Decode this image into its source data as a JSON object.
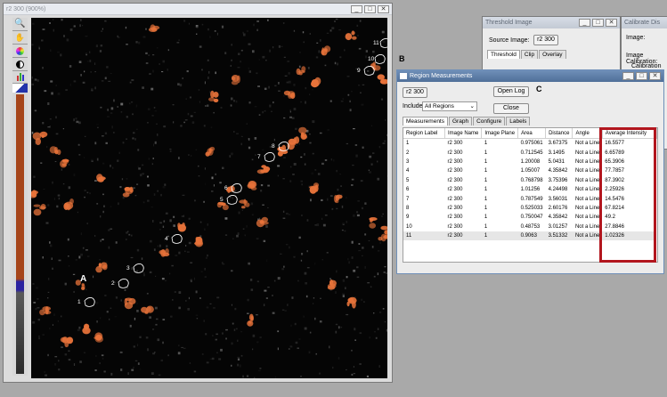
{
  "image_window": {
    "title": "r2 300 (900%)",
    "controls": [
      "_",
      "□",
      "✕"
    ],
    "tools": [
      "zoom-icon",
      "pan-icon",
      "color-wheel-icon",
      "contrast-icon",
      "histogram-icon",
      "arrow-icon"
    ],
    "region_labels": [
      "1",
      "2",
      "3",
      "4",
      "5",
      "6",
      "7",
      "8",
      "9",
      "10",
      "11"
    ],
    "panel_label": "A",
    "highlight_color": "#e8733a"
  },
  "threshold_window": {
    "title": "Threshold Image",
    "source_label": "Source Image:",
    "source_value": "r2 300",
    "tabs": [
      "Threshold",
      "Clip",
      "Overlay"
    ]
  },
  "calibrate_window": {
    "title": "Calibrate Dis",
    "image_label": "Image:",
    "calibration_label": "Image Calibration:",
    "calibration_tab": "Calibration"
  },
  "region_window": {
    "panel_label_b": "B",
    "panel_label_c": "C",
    "title": "Region Measurements",
    "image_button": "r2 300",
    "open_log_button": "Open Log",
    "include_label": "Include:",
    "include_value": "All Regions",
    "close_button": "Close",
    "tabs": [
      "Measurements",
      "Graph",
      "Configure",
      "Labels"
    ],
    "columns": [
      "Region Label",
      "Image Name",
      "Image Plane",
      "Area",
      "Distance",
      "Angle",
      "Average Intensity"
    ],
    "rows": [
      [
        "1",
        "r2 300",
        "1",
        "0.975061",
        "3.67375",
        "Not a Line",
        "16.5577"
      ],
      [
        "2",
        "r2 300",
        "1",
        "0.712545",
        "3.1495",
        "Not a Line",
        "6.65789"
      ],
      [
        "3",
        "r2 300",
        "1",
        "1.20008",
        "5.0431",
        "Not a Line",
        "65.3906"
      ],
      [
        "4",
        "r2 300",
        "1",
        "1.05007",
        "4.35842",
        "Not a Line",
        "77.7857"
      ],
      [
        "5",
        "r2 300",
        "1",
        "0.768798",
        "3.75396",
        "Not a Line",
        "87.3902"
      ],
      [
        "6",
        "r2 300",
        "1",
        "1.01256",
        "4.24498",
        "Not a Line",
        "2.25926"
      ],
      [
        "7",
        "r2 300",
        "1",
        "0.787549",
        "3.56031",
        "Not a Line",
        "14.5476"
      ],
      [
        "8",
        "r2 300",
        "1",
        "0.525033",
        "2.60176",
        "Not a Line",
        "67.8214"
      ],
      [
        "9",
        "r2 300",
        "1",
        "0.750047",
        "4.35842",
        "Not a Line",
        "49.2"
      ],
      [
        "10",
        "r2 300",
        "1",
        "0.48753",
        "3.01257",
        "Not a Line",
        "27.8846"
      ],
      [
        "11",
        "r2 300",
        "1",
        "0.9063",
        "3.51332",
        "Not a Line",
        "1.02326"
      ]
    ],
    "highlight_color": "#b2161e"
  }
}
